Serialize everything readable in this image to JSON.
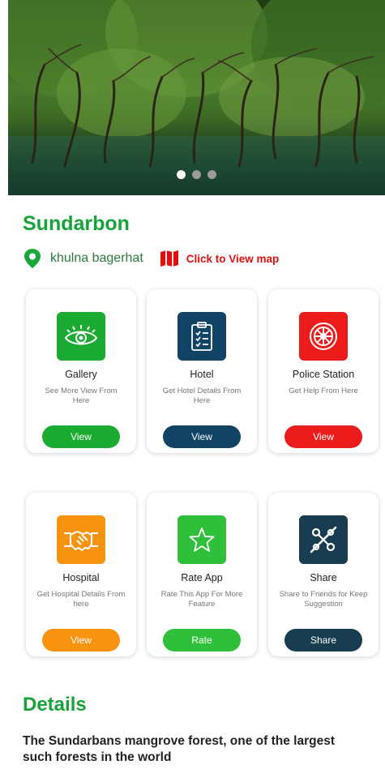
{
  "hero": {
    "slides": [
      true,
      false,
      false
    ]
  },
  "place": {
    "title": "Sundarbon",
    "location": "khulna bagerhat",
    "map_link": "Click to View map"
  },
  "cards": [
    {
      "title": "Gallery",
      "desc": "See More View From Here",
      "button": "View",
      "color": "#1bab33",
      "icon": "eye-icon"
    },
    {
      "title": "Hotel",
      "desc": "Get Hotel Details From Here",
      "button": "View",
      "color": "#114364",
      "icon": "clipboard-icon"
    },
    {
      "title": "Police Station",
      "desc": "Get Help From Here",
      "button": "View",
      "color": "#ec1c1c",
      "icon": "wheel-icon"
    },
    {
      "title": "Hospital",
      "desc": "Get Hospital Details From here",
      "button": "View",
      "color": "#f7930f",
      "icon": "handshake-icon"
    },
    {
      "title": "Rate App",
      "desc": "Rate This App For More Feature",
      "button": "Rate",
      "color": "#2fbf3b",
      "icon": "star-icon"
    },
    {
      "title": "Share",
      "desc": "Share to Friends for Keep Suggestion",
      "button": "Share",
      "color": "#183c50",
      "icon": "share-icon"
    }
  ],
  "details": {
    "title": "Details",
    "text": "The Sundarbans mangrove forest, one of the largest such forests in the world"
  }
}
